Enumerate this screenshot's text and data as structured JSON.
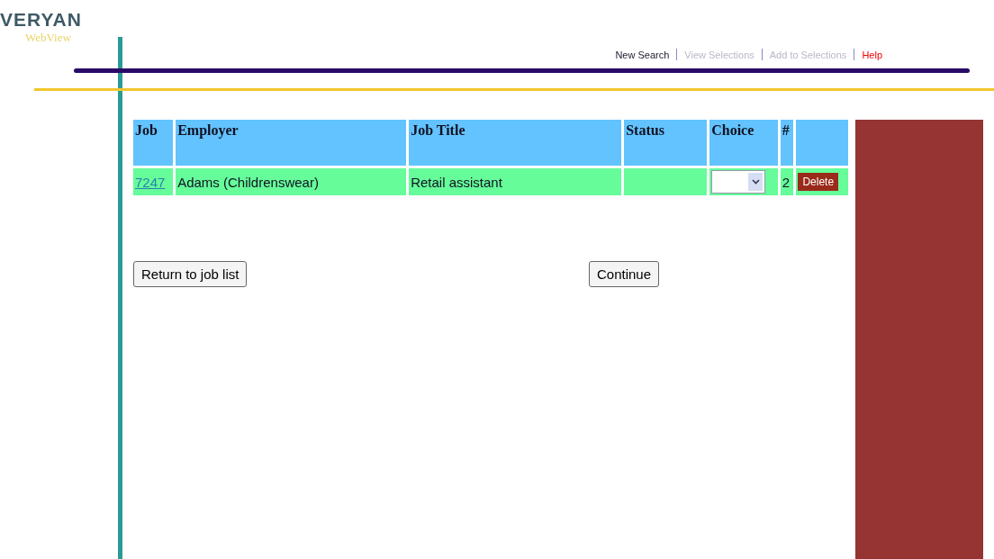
{
  "logo": {
    "brand": "VERYAN",
    "product": "WebView"
  },
  "nav": [
    {
      "label": "New Search",
      "disabled": false,
      "kind": "link"
    },
    {
      "label": "View Selections",
      "disabled": true,
      "kind": "link"
    },
    {
      "label": "Add to Selections",
      "disabled": true,
      "kind": "link"
    },
    {
      "label": "Help",
      "disabled": false,
      "kind": "help"
    }
  ],
  "table": {
    "columns": [
      "Job",
      "Employer",
      "Job Title",
      "Status",
      "Choice",
      "#"
    ],
    "rows": [
      {
        "job": "7247",
        "employer": "Adams (Childrenswear)",
        "job_title": "Retail assistant",
        "number": "2",
        "delete": "Delete"
      }
    ]
  },
  "buttons": [
    "Return to job list",
    "Continue"
  ]
}
